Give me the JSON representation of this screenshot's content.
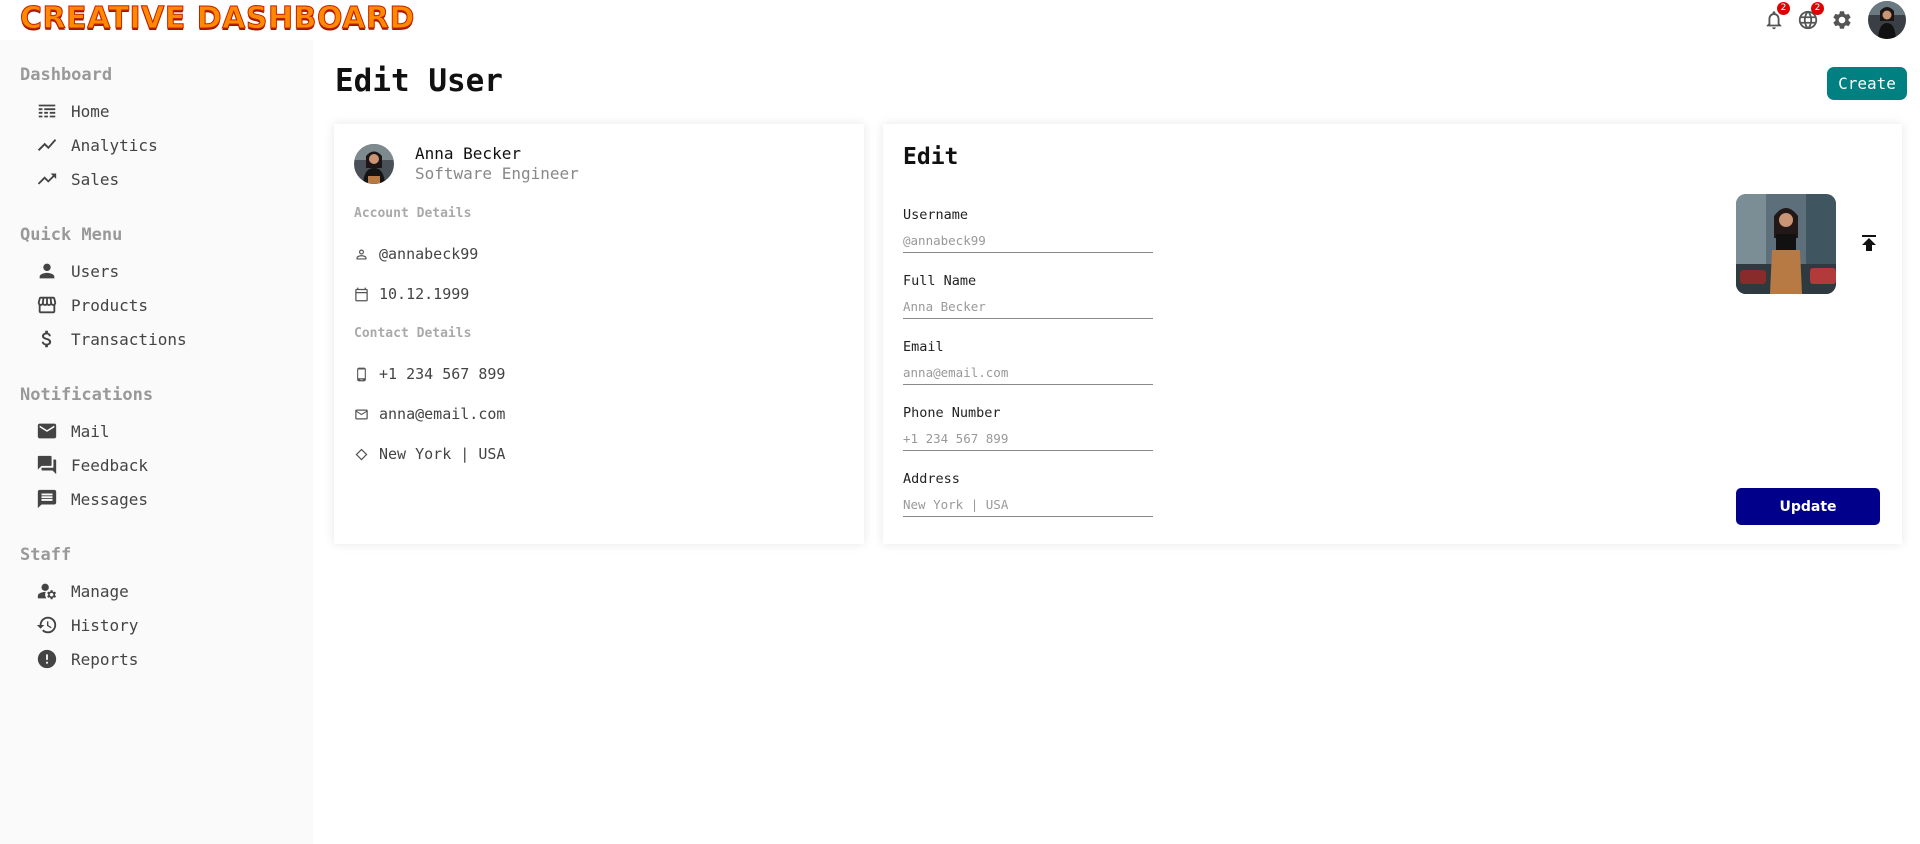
{
  "app": {
    "logo": "CREATIVE DASHBOARD"
  },
  "topbar": {
    "notifications_badge": "2",
    "language_badge": "2",
    "icons": [
      "bell-icon",
      "globe-icon",
      "gear-icon",
      "avatar"
    ]
  },
  "sidebar": {
    "sections": [
      {
        "title": "Dashboard",
        "items": [
          {
            "label": "Home",
            "icon": "home-icon"
          },
          {
            "label": "Analytics",
            "icon": "line-chart-icon"
          },
          {
            "label": "Sales",
            "icon": "trending-up-icon"
          }
        ]
      },
      {
        "title": "Quick Menu",
        "items": [
          {
            "label": "Users",
            "icon": "person-icon"
          },
          {
            "label": "Products",
            "icon": "storefront-icon"
          },
          {
            "label": "Transactions",
            "icon": "dollar-icon"
          }
        ]
      },
      {
        "title": "Notifications",
        "items": [
          {
            "label": "Mail",
            "icon": "mail-icon"
          },
          {
            "label": "Feedback",
            "icon": "forum-icon"
          },
          {
            "label": "Messages",
            "icon": "message-icon"
          }
        ]
      },
      {
        "title": "Staff",
        "items": [
          {
            "label": "Manage",
            "icon": "manage-accounts-icon"
          },
          {
            "label": "History",
            "icon": "history-icon"
          },
          {
            "label": "Reports",
            "icon": "report-icon"
          }
        ]
      }
    ]
  },
  "main": {
    "title": "Edit User",
    "create_label": "Create"
  },
  "user_card": {
    "name": "Anna Becker",
    "role": "Software Engineer",
    "account_title": "Account Details",
    "username": "@annabeck99",
    "birthday": "10.12.1999",
    "contact_title": "Contact Details",
    "phone": "+1 234 567 899",
    "email": "anna@email.com",
    "address": "New York | USA"
  },
  "edit_card": {
    "title": "Edit",
    "fields": [
      {
        "label": "Username",
        "placeholder": "@annabeck99"
      },
      {
        "label": "Full Name",
        "placeholder": "Anna Becker"
      },
      {
        "label": "Email",
        "placeholder": "anna@email.com"
      },
      {
        "label": "Phone Number",
        "placeholder": "+1 234 567 899"
      },
      {
        "label": "Address",
        "placeholder": "New York | USA"
      }
    ],
    "update_label": "Update"
  },
  "colors": {
    "accent": "#008080",
    "update": "#00008b",
    "badge": "#e00000",
    "sidebar_bg": "#fafafa"
  }
}
